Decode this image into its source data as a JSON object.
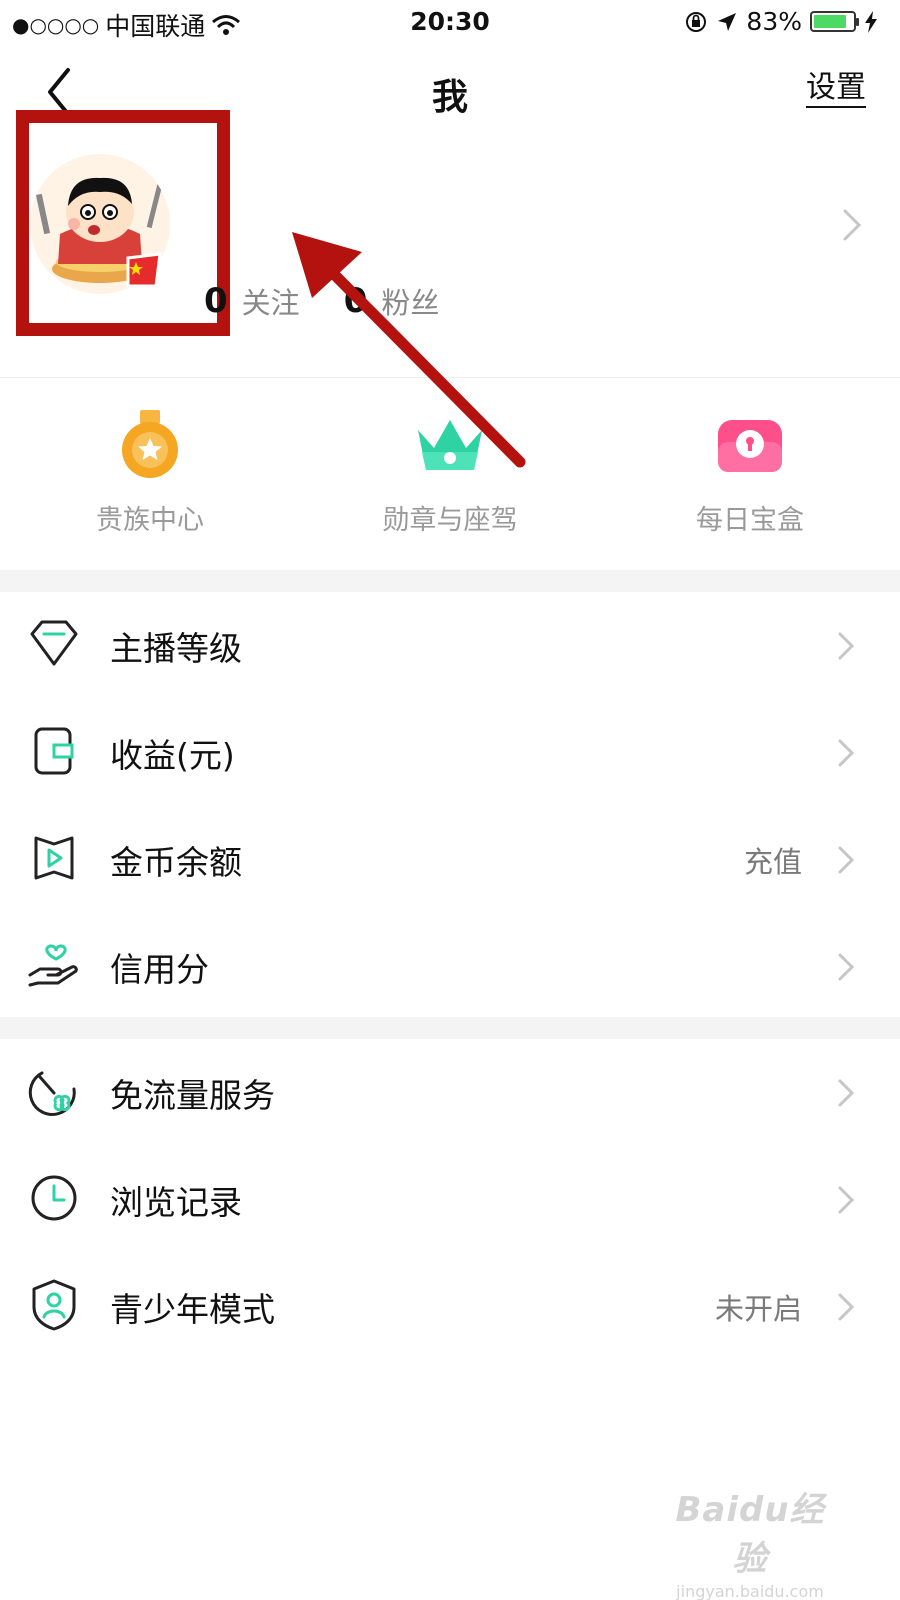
{
  "status_bar": {
    "signal": "●○○○○",
    "carrier": "中国联通",
    "time": "20:30",
    "battery_percent": "83%",
    "battery_level": 0.83
  },
  "nav": {
    "title": "我",
    "settings": "设置"
  },
  "profile": {
    "follow_count": "0",
    "follow_label": "关注",
    "fans_count": "0",
    "fans_label": "粉丝"
  },
  "quick_grid": [
    {
      "label": "贵族中心",
      "icon": "noble-medal-icon"
    },
    {
      "label": "勋章与座驾",
      "icon": "crown-icon"
    },
    {
      "label": "每日宝盒",
      "icon": "treasure-box-icon"
    }
  ],
  "list_section1": [
    {
      "label": "主播等级",
      "icon": "diamond-icon",
      "value": ""
    },
    {
      "label": "收益(元)",
      "icon": "wallet-icon",
      "value": ""
    },
    {
      "label": "金币余额",
      "icon": "coin-play-icon",
      "value": "充值"
    },
    {
      "label": "信用分",
      "icon": "heart-hand-icon",
      "value": ""
    }
  ],
  "list_section2": [
    {
      "label": "免流量服务",
      "icon": "data-free-icon",
      "value": ""
    },
    {
      "label": "浏览记录",
      "icon": "clock-icon",
      "value": ""
    },
    {
      "label": "青少年模式",
      "icon": "shield-user-icon",
      "value": "未开启"
    }
  ],
  "watermark": {
    "logo": "Baidu经验",
    "url": "jingyan.baidu.com"
  },
  "colors": {
    "accent_green": "#2fd3a3",
    "annotation_red": "#b3120e",
    "medal_orange": "#f5a623",
    "box_pink": "#ff4f8b"
  }
}
